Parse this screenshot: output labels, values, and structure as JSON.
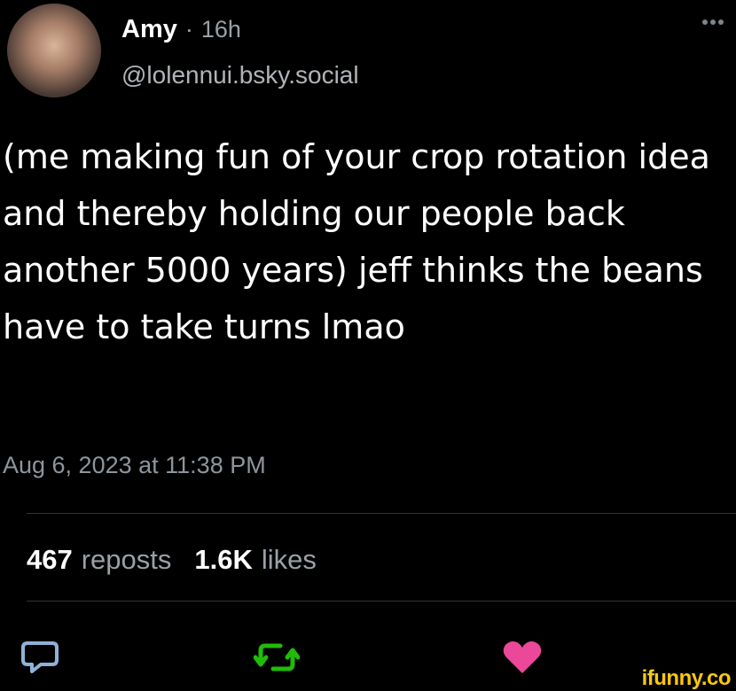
{
  "post": {
    "author_name": "Amy",
    "separator": "·",
    "age": "16h",
    "handle": "@lolennui.bsky.social",
    "text": "(me making fun of your crop rotation idea and thereby holding our people back another 5000 years) jeff thinks the beans have to take turns lmao",
    "timestamp": "Aug 6, 2023 at 11:38 PM"
  },
  "stats": {
    "reposts_count": "467",
    "reposts_label": "reposts",
    "likes_count": "1.6K",
    "likes_label": "likes"
  },
  "actions": {
    "reply_icon": "speech-bubble-icon",
    "repost_icon": "repost-arrows-icon",
    "like_icon": "heart-icon"
  },
  "colors": {
    "background": "#000000",
    "repost_green": "#20bc07",
    "like_pink": "#ec4899",
    "reply_blue": "#8fb2d8"
  },
  "watermark": "ifunny.co"
}
